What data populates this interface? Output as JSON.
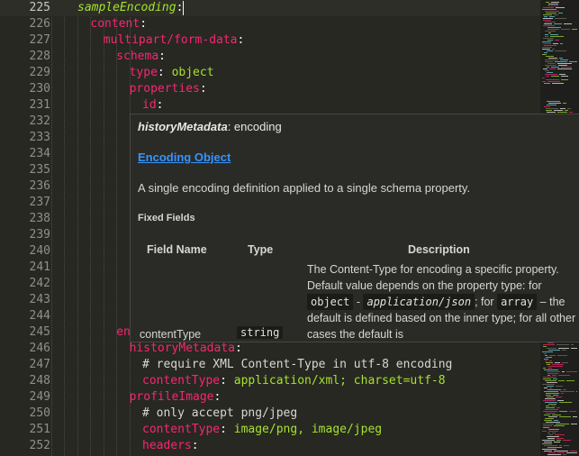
{
  "editor": {
    "lines": [
      {
        "num": "225",
        "indent": 0,
        "tokens": [
          {
            "t": "sampleEncoding",
            "c": "i"
          },
          {
            "t": ":",
            "c": "p"
          }
        ],
        "current": true
      },
      {
        "num": "226",
        "indent": 1,
        "tokens": [
          {
            "t": "content",
            "c": "k"
          },
          {
            "t": ":",
            "c": "p"
          }
        ]
      },
      {
        "num": "227",
        "indent": 2,
        "tokens": [
          {
            "t": "multipart/form-data",
            "c": "k"
          },
          {
            "t": ":",
            "c": "p"
          }
        ]
      },
      {
        "num": "228",
        "indent": 3,
        "tokens": [
          {
            "t": "schema",
            "c": "k"
          },
          {
            "t": ":",
            "c": "p"
          }
        ]
      },
      {
        "num": "229",
        "indent": 4,
        "tokens": [
          {
            "t": "type",
            "c": "k"
          },
          {
            "t": ": ",
            "c": "p"
          },
          {
            "t": "object",
            "c": "s"
          }
        ]
      },
      {
        "num": "230",
        "indent": 4,
        "tokens": [
          {
            "t": "properties",
            "c": "k"
          },
          {
            "t": ":",
            "c": "p"
          }
        ]
      },
      {
        "num": "231",
        "indent": 5,
        "tokens": [
          {
            "t": "id",
            "c": "k"
          },
          {
            "t": ":",
            "c": "p"
          }
        ]
      },
      {
        "num": "232",
        "indent": 0,
        "tokens": []
      },
      {
        "num": "233",
        "indent": 0,
        "tokens": []
      },
      {
        "num": "234",
        "indent": 0,
        "tokens": []
      },
      {
        "num": "235",
        "indent": 0,
        "tokens": []
      },
      {
        "num": "236",
        "indent": 0,
        "tokens": []
      },
      {
        "num": "237",
        "indent": 0,
        "tokens": []
      },
      {
        "num": "238",
        "indent": 0,
        "tokens": []
      },
      {
        "num": "239",
        "indent": 0,
        "tokens": []
      },
      {
        "num": "240",
        "indent": 0,
        "tokens": []
      },
      {
        "num": "241",
        "indent": 0,
        "tokens": []
      },
      {
        "num": "242",
        "indent": 0,
        "tokens": []
      },
      {
        "num": "243",
        "indent": 0,
        "tokens": []
      },
      {
        "num": "244",
        "indent": 0,
        "tokens": []
      },
      {
        "num": "245",
        "indent": 3,
        "tokens": [
          {
            "t": "en",
            "c": "k"
          }
        ]
      },
      {
        "num": "246",
        "indent": 4,
        "tokens": [
          {
            "t": "historyMetadata",
            "c": "k"
          },
          {
            "t": ":",
            "c": "p"
          }
        ]
      },
      {
        "num": "247",
        "indent": 5,
        "tokens": [
          {
            "t": "# require XML Content-Type in utf-8 encoding",
            "c": "c"
          }
        ]
      },
      {
        "num": "248",
        "indent": 5,
        "tokens": [
          {
            "t": "contentType",
            "c": "k"
          },
          {
            "t": ": ",
            "c": "p"
          },
          {
            "t": "application/xml; charset=utf-8",
            "c": "s"
          }
        ]
      },
      {
        "num": "249",
        "indent": 4,
        "tokens": [
          {
            "t": "profileImage",
            "c": "k"
          },
          {
            "t": ":",
            "c": "p"
          }
        ]
      },
      {
        "num": "250",
        "indent": 5,
        "tokens": [
          {
            "t": "# only accept png/jpeg",
            "c": "c"
          }
        ]
      },
      {
        "num": "251",
        "indent": 5,
        "tokens": [
          {
            "t": "contentType",
            "c": "k"
          },
          {
            "t": ": ",
            "c": "p"
          },
          {
            "t": "image/png, image/jpeg",
            "c": "s"
          }
        ]
      },
      {
        "num": "252",
        "indent": 5,
        "tokens": [
          {
            "t": "headers",
            "c": "k"
          },
          {
            "t": ":",
            "c": "p"
          }
        ]
      }
    ]
  },
  "hover": {
    "title_key": "historyMetadata",
    "title_rest": ": encoding",
    "link": "Encoding Object",
    "description": "A single encoding definition applied to a single schema property.",
    "fixed_fields": "Fixed Fields",
    "headers": {
      "name": "Field Name",
      "type": "Type",
      "description": "Description"
    },
    "row": {
      "name": "contentType",
      "type": "string",
      "desc_1": "The Content-Type for encoding a specific property. Default value depends on the property type: for ",
      "code_1": "object",
      "dash_1": " - ",
      "code_2": "application/json",
      "desc_2": "; for ",
      "code_3": "array",
      "desc_3": " – the default is defined based on the inner type; for all other cases the default is"
    }
  },
  "colors": {
    "background": "#272822",
    "keyword": "#f92672",
    "string": "#a6e22e",
    "link": "#3794ff"
  }
}
